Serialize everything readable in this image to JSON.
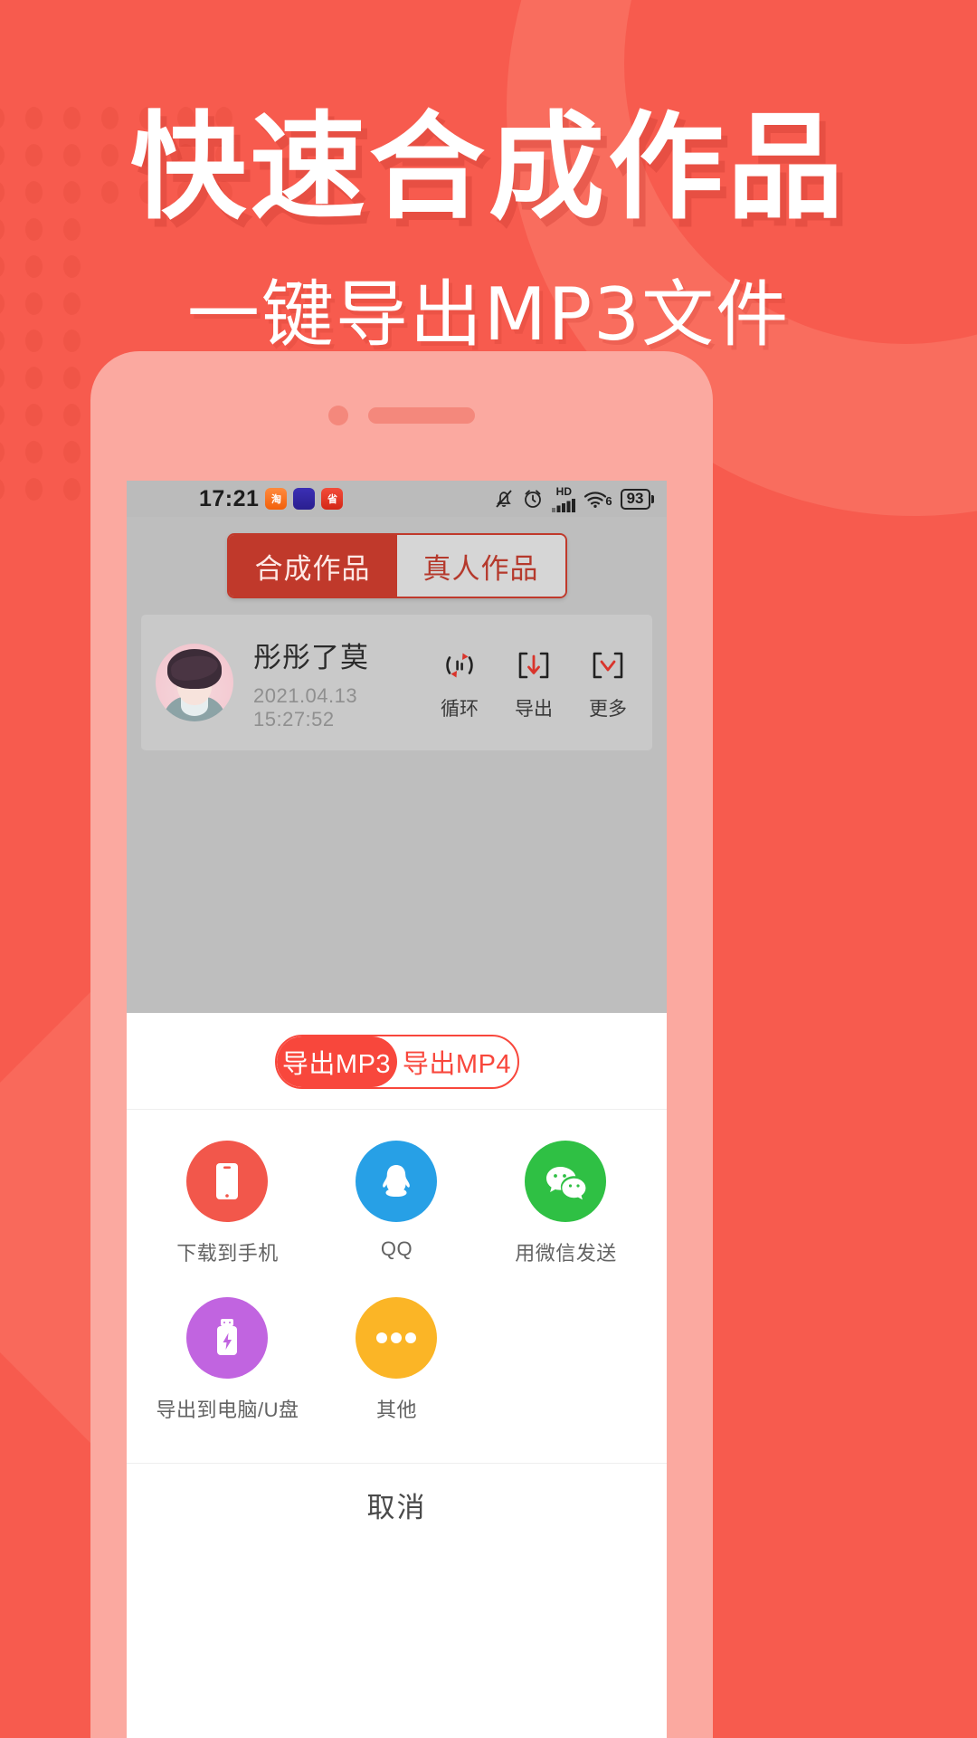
{
  "poster": {
    "headline": "快速合成作品",
    "subheadline": "一键导出MP3文件",
    "bg_color": "#F75B4E",
    "accent_color": "#F8473C"
  },
  "phone": {
    "statusbar": {
      "time": "17:21",
      "app_badges": [
        "淘",
        "app",
        "省"
      ],
      "icons": [
        "bell-muted-icon",
        "alarm-icon",
        "signal-hd-icon",
        "wifi-icon"
      ],
      "network_label": "HD",
      "wifi_label": "6",
      "battery_percent": "93"
    },
    "top_tabs": {
      "items": [
        {
          "label": "合成作品",
          "active": true
        },
        {
          "label": "真人作品",
          "active": false
        }
      ]
    },
    "work_list": [
      {
        "title": "彤彤了莫",
        "date": "2021.04.13 15:27:52",
        "actions": [
          {
            "label": "循环",
            "icon": "loop-icon"
          },
          {
            "label": "导出",
            "icon": "download-bracket-icon"
          },
          {
            "label": "更多",
            "icon": "chevron-down-bracket-icon"
          }
        ]
      }
    ],
    "export_sheet": {
      "format_tabs": [
        {
          "label": "导出MP3",
          "active": true
        },
        {
          "label": "导出MP4",
          "active": false
        }
      ],
      "share_targets": [
        {
          "label": "下载到手机",
          "icon": "phone-icon",
          "color": "#F2574B"
        },
        {
          "label": "QQ",
          "icon": "qq-penguin-icon",
          "color": "#27A0E6"
        },
        {
          "label": "用微信发送",
          "icon": "wechat-icon",
          "color": "#2FC044"
        },
        {
          "label": "导出到电脑/U盘",
          "icon": "usb-drive-icon",
          "color": "#C164E0"
        },
        {
          "label": "其他",
          "icon": "ellipsis-icon",
          "color": "#FBB526"
        }
      ],
      "cancel_label": "取消"
    }
  }
}
